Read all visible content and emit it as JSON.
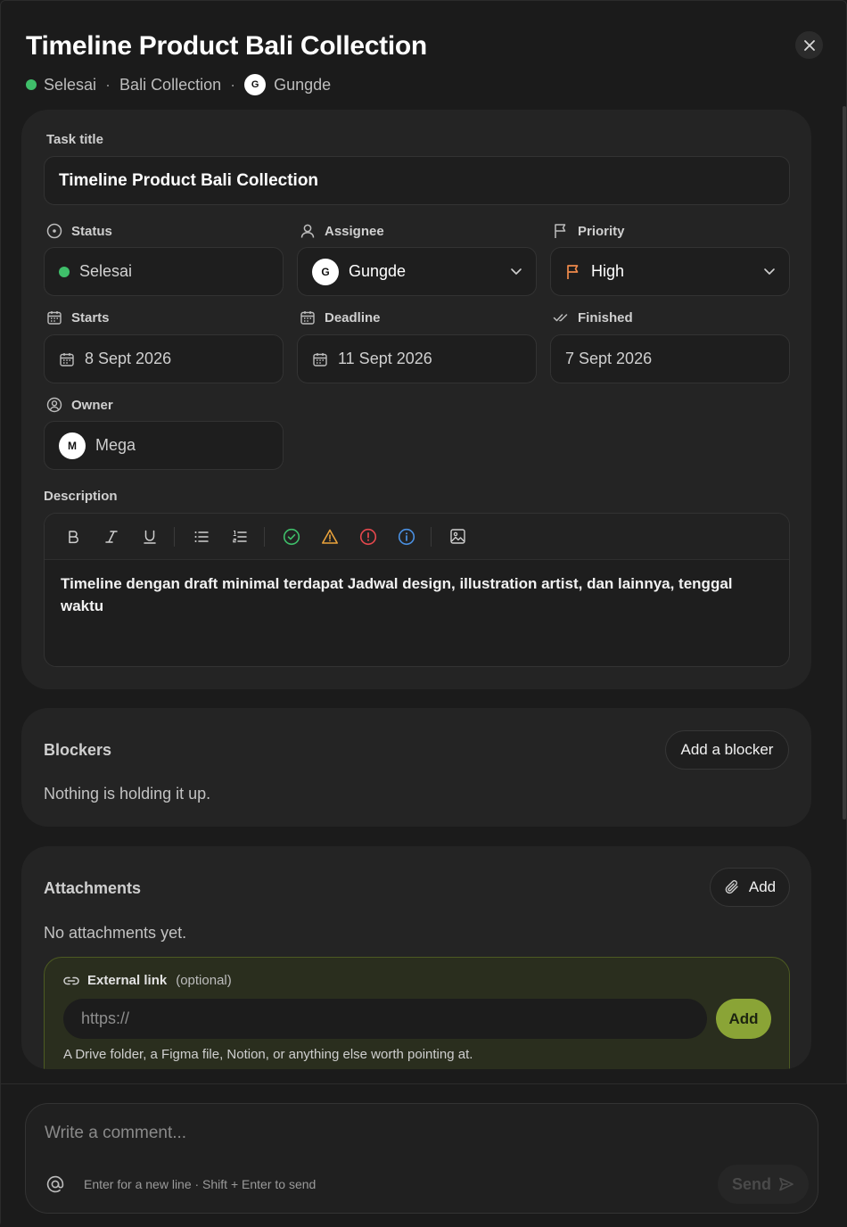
{
  "header": {
    "title": "Timeline Product Bali Collection",
    "status": "Selesai",
    "project": "Bali Collection",
    "assignee_initial": "G",
    "assignee": "Gungde",
    "separator": "·"
  },
  "form": {
    "task_title_label": "Task title",
    "task_title_value": "Timeline Product Bali Collection",
    "status_label": "Status",
    "status_value": "Selesai",
    "assignee_label": "Assignee",
    "assignee_initial": "G",
    "assignee_value": "Gungde",
    "priority_label": "Priority",
    "priority_value": "High",
    "starts_label": "Starts",
    "starts_value": "8 Sept 2026",
    "deadline_label": "Deadline",
    "deadline_value": "11 Sept 2026",
    "finished_label": "Finished",
    "finished_value": "7 Sept 2026",
    "owner_label": "Owner",
    "owner_initial": "M",
    "owner_value": "Mega",
    "description_label": "Description",
    "description_text": "Timeline dengan draft minimal terdapat Jadwal design, illustration artist, dan lainnya, tenggal waktu"
  },
  "blockers": {
    "title": "Blockers",
    "add_label": "Add a blocker",
    "empty_text": "Nothing is holding it up."
  },
  "attachments": {
    "title": "Attachments",
    "add_label": "Add",
    "empty_text": "No attachments yet.",
    "external_label": "External link",
    "external_optional": "(optional)",
    "url_placeholder": "https://",
    "external_add_label": "Add",
    "hint": "A Drive folder, a Figma file, Notion, or anything else worth pointing at."
  },
  "comment": {
    "placeholder": "Write a comment...",
    "hint": "Enter for a new line · Shift + Enter to send",
    "send_label": "Send"
  },
  "colors": {
    "status_green": "#3fbf6a",
    "priority_orange": "#f08a4b",
    "accent_olive": "#8aa436"
  }
}
